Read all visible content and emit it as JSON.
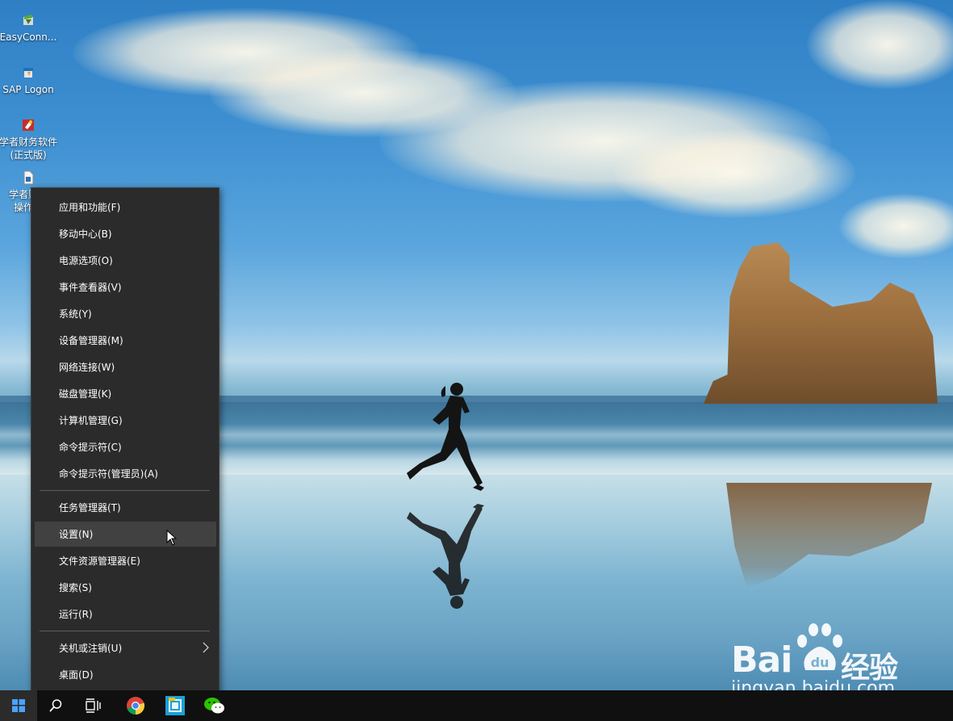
{
  "desktop": {
    "icons": [
      {
        "label": "EasyConn...",
        "icon": "easyconnect-icon"
      },
      {
        "label": "SAP Logon",
        "icon": "sap-logon-icon"
      },
      {
        "label_line1": "学者财务软件",
        "label_line2": "(正式版)",
        "icon": "finance-software-icon"
      },
      {
        "label_line1": "学者财务",
        "label_line2": "操作手",
        "icon": "document-icon"
      }
    ]
  },
  "context_menu": {
    "group1": [
      {
        "label": "应用和功能(F)"
      },
      {
        "label": "移动中心(B)"
      },
      {
        "label": "电源选项(O)"
      },
      {
        "label": "事件查看器(V)"
      },
      {
        "label": "系统(Y)"
      },
      {
        "label": "设备管理器(M)"
      },
      {
        "label": "网络连接(W)"
      },
      {
        "label": "磁盘管理(K)"
      },
      {
        "label": "计算机管理(G)"
      },
      {
        "label": "命令提示符(C)"
      },
      {
        "label": "命令提示符(管理员)(A)"
      }
    ],
    "group2": [
      {
        "label": "任务管理器(T)"
      },
      {
        "label": "设置(N)",
        "state": "hovered"
      },
      {
        "label": "文件资源管理器(E)"
      },
      {
        "label": "搜索(S)"
      },
      {
        "label": "运行(R)"
      }
    ],
    "group3": [
      {
        "label": "关机或注销(U)",
        "has_submenu": true
      },
      {
        "label": "桌面(D)"
      }
    ]
  },
  "taskbar": {
    "buttons": [
      "start-icon",
      "search-icon",
      "task-view-icon",
      "chrome-icon",
      "app-icon",
      "wechat-icon"
    ]
  },
  "watermark": {
    "brand": "Bai",
    "brand_paw_text": "du",
    "brand_cn": "经验",
    "url": "jingyan.baidu.com"
  },
  "colors": {
    "menu_bg": "#2b2b2b",
    "menu_hover": "#414141",
    "taskbar_bg": "#101010"
  }
}
